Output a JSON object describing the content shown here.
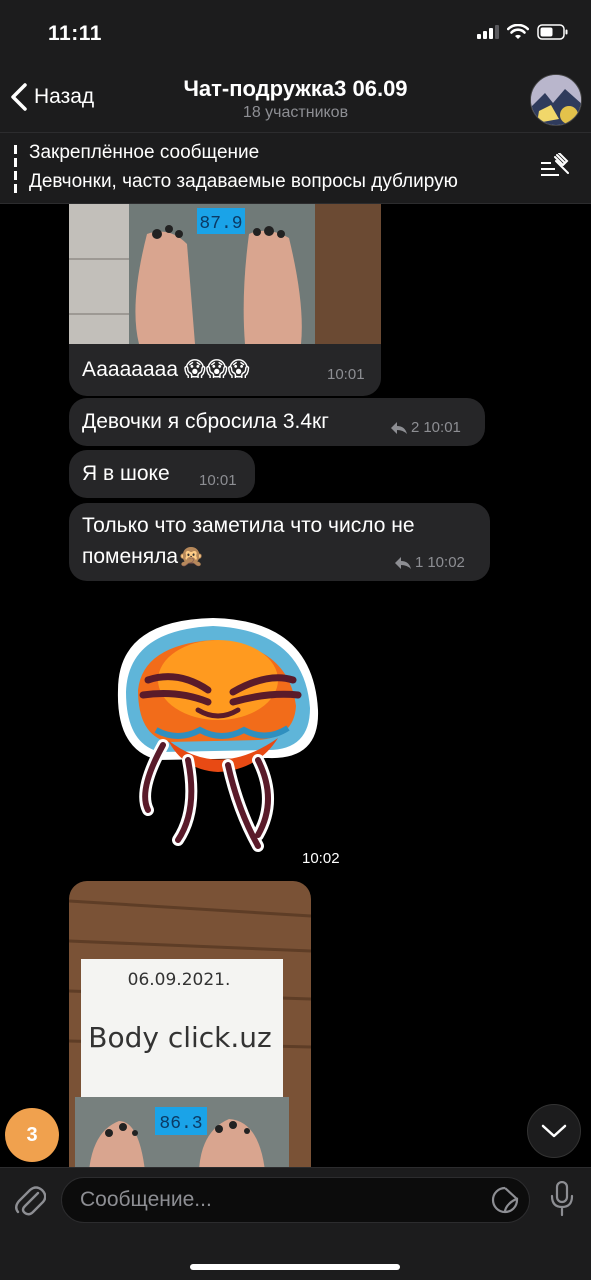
{
  "status_bar": {
    "time": "11:11"
  },
  "header": {
    "back_label": "Назад",
    "title": "Чат-подружка3 06.09",
    "subtitle": "18 участников"
  },
  "pinned": {
    "title": "Закреплённое сообщение",
    "text": "Девчонки, часто задаваемые вопросы дублирую"
  },
  "messages": [
    {
      "text": "Аааааааа 😱😱😱",
      "time": "10:01"
    },
    {
      "text": "Девочки я сбросила 3.4кг",
      "replies": "2",
      "time": "10:01"
    },
    {
      "text": "Я в шоке",
      "time": "10:01"
    },
    {
      "text_line1": "Только что заметила что число не",
      "text_line2": "поменяла🙊",
      "replies": "1",
      "time": "10:02"
    }
  ],
  "sticker": {
    "time": "10:02"
  },
  "photo2": {
    "date_text": "06.09.2021.",
    "brand_text": "Body click.uz",
    "scale_reading": "86.3"
  },
  "photo1": {
    "scale_reading": "87.9"
  },
  "unread_count": "3",
  "composer": {
    "placeholder": "Сообщение..."
  }
}
